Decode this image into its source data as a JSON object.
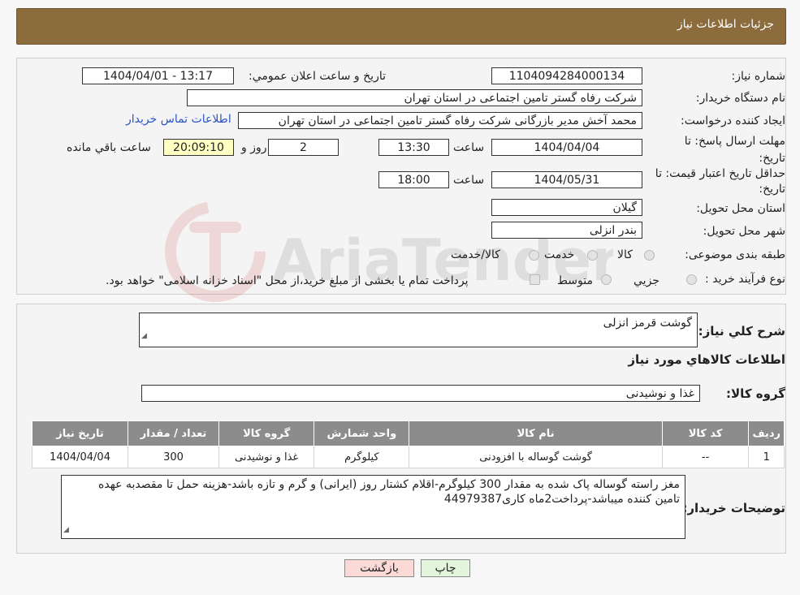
{
  "header": {
    "title": "جزئیات اطلاعات نیاز"
  },
  "watermark": {
    "text": "AriaTender.neT"
  },
  "form": {
    "need_number_label": "شماره نیاز:",
    "need_number": "1104094284000134",
    "announce_label": "تاریخ و ساعت اعلان عمومي:",
    "announce_value": "1404/04/01 - 13:17",
    "buyer_org_label": "نام دستگاه خريدار:",
    "buyer_org": "شرکت رفاه گستر تامین اجتماعی در استان تهران",
    "creator_label": "ايجاد کننده درخواست:",
    "creator": "محمد آخش مدیر بازرگانی شرکت رفاه گستر تامین اجتماعی در استان تهران",
    "contact_link": "اطلاعات تماس خريدار",
    "deadline_label": "مهلت ارسال پاسخ: تا تاریخ:",
    "deadline_date": "1404/04/04",
    "time_label": "ساعت",
    "deadline_time": "13:30",
    "days_value": "2",
    "days_label": "روز و",
    "remaining_time": "20:09:10",
    "remaining_label": "ساعت باقي مانده",
    "validity_label": "حداقل تاريخ اعتبار قيمت: تا تاریخ:",
    "validity_date": "1404/05/31",
    "validity_time": "18:00",
    "province_label": "استان محل تحويل:",
    "province": "گيلان",
    "city_label": "شهر محل تحويل:",
    "city": "بندر انزلی",
    "category_label": "طبقه بندی موضوعی:",
    "category_options": [
      "كالا",
      "خدمت",
      "كالا/خدمت"
    ],
    "process_label": "نوع فرآیند خرید :",
    "process_options": [
      "جزيي",
      "متوسط"
    ],
    "process_note": "پرداخت تمام يا بخشی از مبلغ خريد،از محل \"اسناد خزانه اسلامی\" خواهد بود."
  },
  "details": {
    "summary_label": "شرح کلي نياز:",
    "summary_value": "گوشت قرمز انزلی",
    "goods_info_title": "اطلاعات کالاهاي مورد نياز",
    "goods_group_label": "گروه کالا:",
    "goods_group_value": "غذا و نوشیدنی",
    "table_headers": [
      "رديف",
      "کد کالا",
      "نام کالا",
      "واحد شمارش",
      "گروه کالا",
      "تعداد / مقدار",
      "تاريخ نياز"
    ],
    "table_rows": [
      [
        "1",
        "--",
        "گوشت گوساله با افزودنی",
        "کیلوگرم",
        "غذا و نوشیدنی",
        "300",
        "1404/04/04"
      ]
    ],
    "buyer_notes_label": "توضيحات خريدار:",
    "buyer_notes": "مغز راسته گوساله پاک شده به مقدار 300 کیلوگرم-اقلام کشتار روز (ایرانی) و گرم و تازه باشد-هزینه حمل تا مقصدبه عهده تامین کننده میباشد-پرداخت2ماه کاری44979387"
  },
  "buttons": {
    "print": "چاپ",
    "back": "بازگشت"
  },
  "colors": {
    "header": "#8c6b3c",
    "link": "#2a55c8",
    "remaining_bg": "#ffffc4",
    "back_bg": "#fbd9d7",
    "print_bg": "#e3f5dc"
  }
}
